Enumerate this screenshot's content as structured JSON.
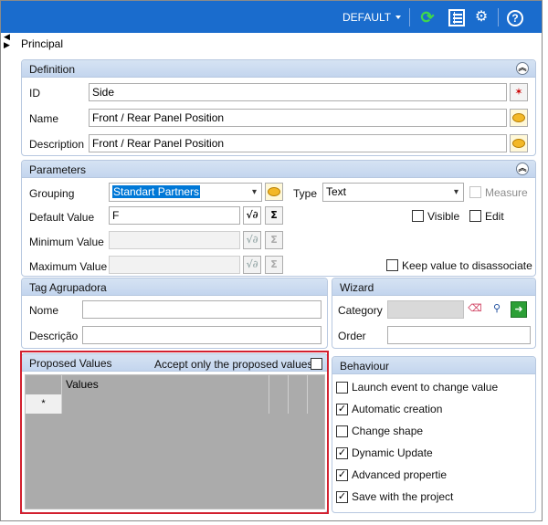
{
  "toolbar": {
    "mode_label": "DEFAULT",
    "refresh_icon": "refresh-icon",
    "list_icon": "list-icon",
    "settings_icon": "gear-icon",
    "help_icon": "help-icon",
    "help_glyph": "?"
  },
  "tab": {
    "label": "Principal"
  },
  "definition": {
    "title": "Definition",
    "id_label": "ID",
    "id_value": "Side",
    "name_label": "Name",
    "name_value": "Front / Rear Panel Position",
    "description_label": "Description",
    "description_value": "Front / Rear Panel Position"
  },
  "parameters": {
    "title": "Parameters",
    "grouping_label": "Grouping",
    "grouping_value": "Standart Partners",
    "type_label": "Type",
    "type_value": "Text",
    "measure_label": "Measure",
    "measure_checked": false,
    "default_value_label": "Default Value",
    "default_value": "F",
    "minimum_value_label": "Minimum Value",
    "minimum_value": "",
    "maximum_value_label": "Maximum Value",
    "maximum_value": "",
    "visible_label": "Visible",
    "visible_checked": false,
    "edit_label": "Edit",
    "edit_checked": false,
    "keep_label": "Keep value to disassociate",
    "keep_checked": false,
    "fx_glyph": "√∂",
    "sigma_glyph": "Σ"
  },
  "tag": {
    "title": "Tag Agrupadora",
    "nome_label": "Nome",
    "nome_value": "",
    "descricao_label": "Descrição",
    "descricao_value": ""
  },
  "wizard": {
    "title": "Wizard",
    "category_label": "Category",
    "category_value": "",
    "order_label": "Order",
    "order_value": ""
  },
  "proposed": {
    "title": "Proposed Values",
    "accept_label": "Accept only the proposed values",
    "accept_checked": false,
    "column_header": "Values",
    "new_row_marker": "*"
  },
  "behaviour": {
    "title": "Behaviour",
    "items": [
      {
        "label": "Launch event to change value",
        "checked": false
      },
      {
        "label": "Automatic creation",
        "checked": true
      },
      {
        "label": "Change shape",
        "checked": false
      },
      {
        "label": "Dynamic Update",
        "checked": true
      },
      {
        "label": "Advanced propertie",
        "checked": true
      },
      {
        "label": "Save with the project",
        "checked": true
      }
    ]
  },
  "colors": {
    "toolbar": "#1a6ccd",
    "group_header": "#c9d9ef",
    "highlight": "#d2202f"
  }
}
